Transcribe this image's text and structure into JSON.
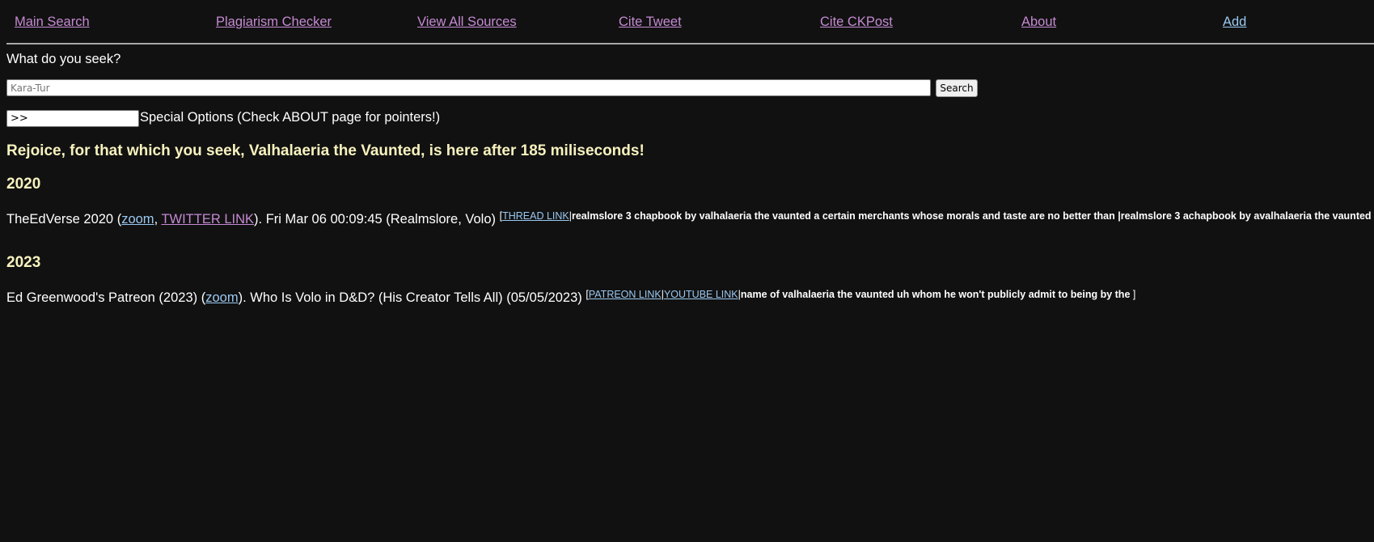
{
  "nav": {
    "main_search": "Main Search",
    "plagiarism_checker": "Plagiarism Checker",
    "view_all_sources": "View All Sources",
    "cite_tweet": "Cite Tweet",
    "cite_ckpost": "Cite CKPost",
    "about": "About",
    "add": "Add"
  },
  "search": {
    "prompt": "What do you seek?",
    "placeholder": "Kara-Tur",
    "button": "Search",
    "special_value": ">>",
    "special_label": "Special Options (Check ABOUT page for pointers!)"
  },
  "result_banner": "Rejoice, for that which you seek, Valhalaeria the Vaunted, is here after 185 miliseconds!",
  "results": [
    {
      "year": "2020",
      "source": "TheEdVerse 2020",
      "zoom": "zoom",
      "twitter": "TWITTER LINK",
      "detail": ". Fri Mar 06 00:09:45 (Realmslore, Volo)",
      "thread": "THREAD LINK",
      "snippet": "realmslore 3 chapbook by valhalaeria the vaunted a certain merchants whose morals and taste are no better than |realmslore 3 achapbook by avalhalaeria the vaunted "
    },
    {
      "year": "2023",
      "source": "Ed Greenwood's Patreon (2023)",
      "zoom": "zoom",
      "detail": ". Who Is Volo in D&D? (His Creator Tells All) (05/05/2023)",
      "patreon": "PATREON LINK",
      "youtube": "YOUTUBE LINK",
      "snippet": "name of valhalaeria the vaunted uh whom he won't publicly admit to being by the "
    }
  ],
  "colors": {
    "background": "#111111",
    "visited_link": "#c58ad2",
    "unvisited_link": "#9ac9f2",
    "heading": "#f7f2be"
  }
}
